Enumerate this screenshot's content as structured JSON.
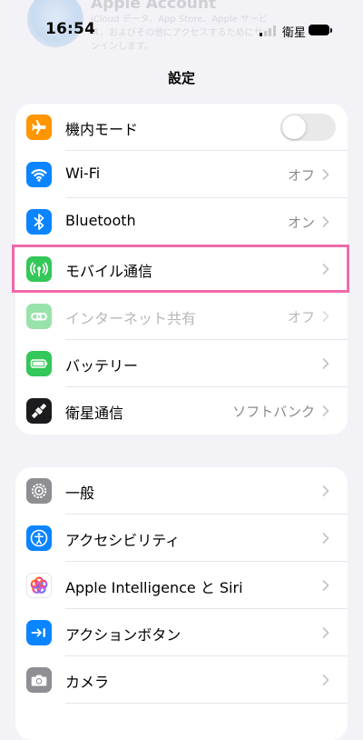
{
  "status": {
    "time": "16:54",
    "carrier": "衛星"
  },
  "header": {
    "account_title": "Apple Account",
    "account_subtitle": "iCloud データ、App Store、Apple サービス、およびその他にアクセスするためにサインインします。"
  },
  "title": "設定",
  "group1": [
    {
      "label": "機内モード",
      "icon": "airplane-icon",
      "color": "#ff9500",
      "toggle": false
    },
    {
      "label": "Wi-Fi",
      "value": "オフ",
      "icon": "wifi-icon",
      "color": "#0a84ff"
    },
    {
      "label": "Bluetooth",
      "value": "オン",
      "icon": "bluetooth-icon",
      "color": "#0a84ff"
    },
    {
      "label": "モバイル通信",
      "value": "",
      "icon": "antenna-icon",
      "color": "#34c759",
      "highlighted": true
    },
    {
      "label": "インターネット共有",
      "value": "オフ",
      "icon": "link-icon",
      "color": "#34c759",
      "disabled": true
    },
    {
      "label": "バッテリー",
      "value": "",
      "icon": "battery-icon",
      "color": "#34c759"
    },
    {
      "label": "衛星通信",
      "value": "ソフトバンク",
      "icon": "satellite-icon",
      "color": "#1c1c1e"
    }
  ],
  "group2": [
    {
      "label": "一般",
      "icon": "gear-icon",
      "color": "#8e8e93"
    },
    {
      "label": "アクセシビリティ",
      "icon": "accessibility-icon",
      "color": "#0a84ff"
    },
    {
      "label": "Apple Intelligence と Siri",
      "icon": "siri-icon",
      "color": "#bf5af2"
    },
    {
      "label": "アクションボタン",
      "icon": "action-button-icon",
      "color": "#0a84ff"
    },
    {
      "label": "カメラ",
      "icon": "camera-icon",
      "color": "#8e8e93"
    }
  ],
  "colors": {
    "highlight": "#f06aaa",
    "background": "#f2f2f7"
  }
}
